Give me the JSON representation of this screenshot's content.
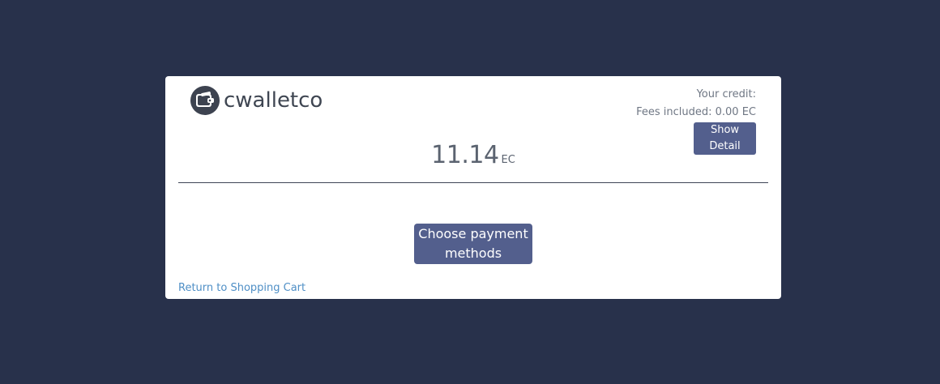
{
  "brand": {
    "name": "cwalletco"
  },
  "credit": {
    "label": "Your credit:",
    "fees": "Fees included: 0.00 EC",
    "detail_button": "Show Detail"
  },
  "amount": {
    "value": "11.14",
    "unit": "EC"
  },
  "payment": {
    "line1": "Choose payment",
    "line2": "methods"
  },
  "footer": {
    "return_link": "Return to Shopping Cart"
  },
  "colors": {
    "background": "#28314b",
    "card": "#ffffff",
    "button": "#535f8d",
    "link": "#4f8fc6"
  }
}
